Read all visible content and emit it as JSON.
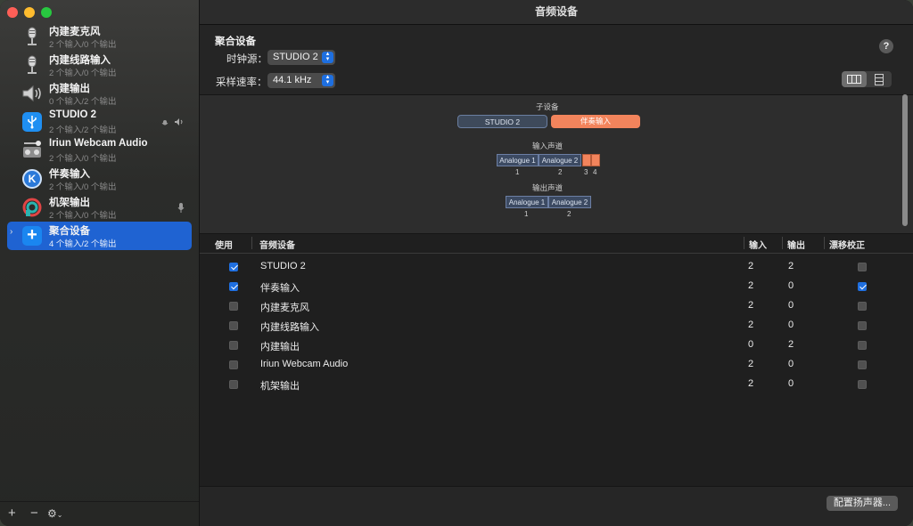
{
  "window": {
    "title": "音频设备"
  },
  "sidebar": {
    "devices": [
      {
        "name": "内建麦克风",
        "sub": "2 个输入/0 个输出",
        "icon": "microphone-icon"
      },
      {
        "name": "内建线路输入",
        "sub": "2 个输入/0 个输出",
        "icon": "line-in-icon"
      },
      {
        "name": "内建输出",
        "sub": "0 个输入/2 个输出",
        "icon": "speaker-icon"
      },
      {
        "name": "STUDIO 2",
        "sub": "2 个输入/2 个输出",
        "icon": "usb-icon",
        "badge": "mic-speaker-badge"
      },
      {
        "name": "Iriun Webcam Audio",
        "sub": "2 个输入/0 个输出",
        "icon": "webcam-audio-icon"
      },
      {
        "name": "伴奏输入",
        "sub": "2 个输入/0 个输出",
        "icon": "k-app-icon"
      },
      {
        "name": "机架输出",
        "sub": "2 个输入/0 个输出",
        "icon": "rack-app-icon",
        "badge": "mic-badge"
      },
      {
        "name": "聚合设备",
        "sub": "4 个输入/2 个输出",
        "icon": "aggregate-plus-icon",
        "selected": true
      }
    ],
    "bottom": {
      "add": "+",
      "remove": "−",
      "gear": "⚙"
    }
  },
  "header": {
    "section_title": "聚合设备",
    "clock_label": "时钟源：",
    "clock_value": "STUDIO 2",
    "rate_label": "采样速率：",
    "rate_value": "44.1 kHz",
    "help": "?"
  },
  "diagram": {
    "subdevices_label": "子设备",
    "subdevices": [
      "STUDIO 2",
      "伴奏输入"
    ],
    "input_label": "输入声道",
    "input_channels": [
      "Analogue 1",
      "Analogue 2"
    ],
    "input_nums": [
      "1",
      "2",
      "3",
      "4"
    ],
    "output_label": "输出声道",
    "output_channels": [
      "Analogue 1",
      "Analogue 2"
    ],
    "output_nums": [
      "1",
      "2"
    ]
  },
  "table": {
    "headers": {
      "use": "使用",
      "device": "音频设备",
      "in": "输入",
      "out": "输出",
      "drift": "漂移校正"
    },
    "rows": [
      {
        "use": true,
        "device": "STUDIO 2",
        "in": "2",
        "out": "2",
        "drift": false
      },
      {
        "use": true,
        "device": "伴奏输入",
        "in": "2",
        "out": "0",
        "drift": true
      },
      {
        "use": false,
        "device": "内建麦克风",
        "in": "2",
        "out": "0",
        "drift": false
      },
      {
        "use": false,
        "device": "内建线路输入",
        "in": "2",
        "out": "0",
        "drift": false
      },
      {
        "use": false,
        "device": "内建输出",
        "in": "0",
        "out": "2",
        "drift": false
      },
      {
        "use": false,
        "device": "Iriun Webcam Audio",
        "in": "2",
        "out": "0",
        "drift": false
      },
      {
        "use": false,
        "device": "机架输出",
        "in": "2",
        "out": "0",
        "drift": false
      }
    ]
  },
  "footer": {
    "config_button": "配置扬声器..."
  }
}
